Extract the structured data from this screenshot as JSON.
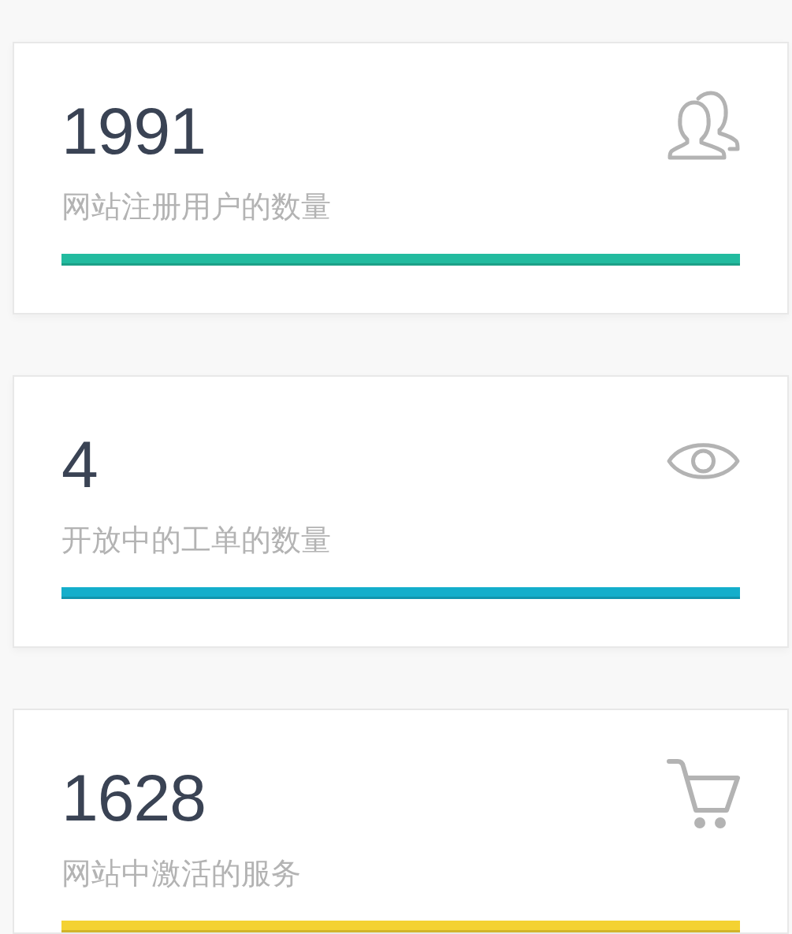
{
  "stats": [
    {
      "kind": "users",
      "value": "1991",
      "label": "网站注册用户的数量",
      "color": "#22bb9f"
    },
    {
      "kind": "tickets",
      "value": "4",
      "label": "开放中的工单的数量",
      "color": "#14aecb"
    },
    {
      "kind": "services",
      "value": "1628",
      "label": "网站中激活的服务",
      "color": "#f4d232"
    }
  ]
}
